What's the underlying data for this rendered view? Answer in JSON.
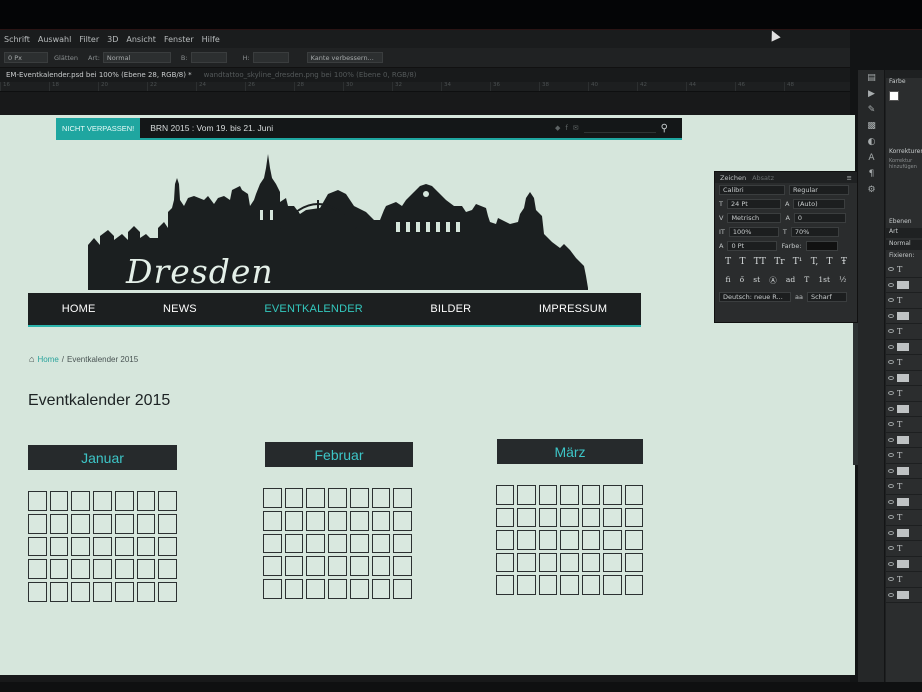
{
  "app": {
    "menu": [
      "Schrift",
      "Auswahl",
      "Filter",
      "3D",
      "Ansicht",
      "Fenster",
      "Hilfe"
    ],
    "options": {
      "size": "0 Px",
      "glaetten": "Glätten",
      "art_label": "Art:",
      "art_value": "Normal",
      "breite_label": "B:",
      "hoehe_label": "H:",
      "kante": "Kante verbessern..."
    },
    "doc_tabs": [
      "EM-Eventkalender.psd bei 100% (Ebene 28, RGB/8) *",
      "wandtattoo_skyline_dresden.png bei 100% (Ebene 0, RGB/8)"
    ],
    "ruler": [
      "16",
      "18",
      "20",
      "22",
      "24",
      "26",
      "28",
      "30",
      "32",
      "34",
      "36",
      "38",
      "40",
      "42",
      "44",
      "46",
      "48"
    ]
  },
  "site": {
    "topbar": {
      "badge": "NICHT VERPASSEN!",
      "text": "BRN 2015 : Vom 19. bis 21. Juni"
    },
    "logo": "Dresden",
    "nav": [
      "HOME",
      "NEWS",
      "EVENTKALENDER",
      "BILDER",
      "IMPRESSUM"
    ],
    "active_nav": "EVENTKALENDER",
    "breadcrumb": {
      "home": "Home",
      "separator": "/",
      "current": "Eventkalender 2015"
    },
    "title": "Eventkalender 2015",
    "months": [
      "Januar",
      "Februar",
      "März"
    ],
    "calendar": {
      "columns": 7,
      "rows": 5
    }
  },
  "character_panel": {
    "tabs": [
      "Zeichen",
      "Absatz"
    ],
    "font_family": "Calibri",
    "font_style": "Regular",
    "size": "24 Pt",
    "leading": "(Auto)",
    "kerning": "Metrisch",
    "tracking": "0",
    "vertical_scale": "100%",
    "horizontal_scale": "70%",
    "baseline": "0 Pt",
    "color_label": "Farbe:",
    "glyphs": [
      "T",
      "T",
      "TT",
      "Tr",
      "T¹",
      "T,",
      "T",
      "Ŧ"
    ],
    "ot_glyphs": [
      "fi",
      "ő",
      "st",
      "Ⓐ",
      "ad",
      "T",
      "1st",
      "½"
    ],
    "language": "Deutsch: neue R...",
    "aa_label": "aa",
    "antialias": "Scharf"
  },
  "right_panels": {
    "farbe": "Farbe",
    "ebenen": "Ebenen",
    "art": "Art",
    "mode": "Normal",
    "fixieren": "Fixieren:",
    "korrekturen": "Korrekturen",
    "korrektur_hint": "Korrektur hinzufügen"
  },
  "colors": {
    "accent": "#1fa6a0",
    "nav_bg": "#1c1f20",
    "month_text": "#3dc5c7",
    "canvas_bg": "#d6e6dc"
  }
}
